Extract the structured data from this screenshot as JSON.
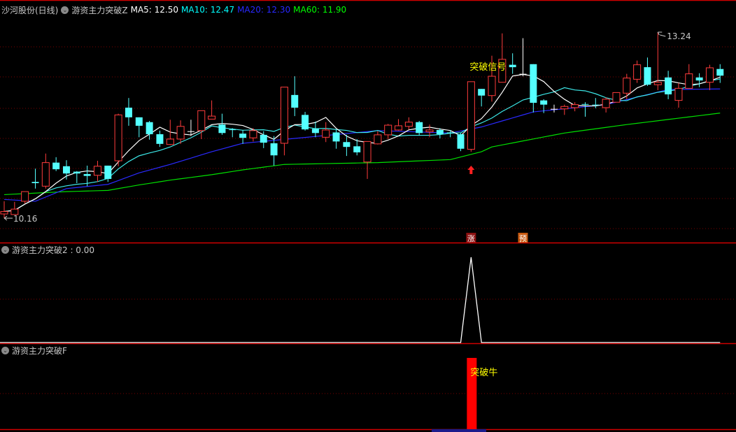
{
  "header": {
    "stock": "沙河股份(日线)",
    "indicator": "游资主力突破Z",
    "ma5": "MA5: 12.50",
    "ma10": "MA10: 12.47",
    "ma20": "MA20: 12.30",
    "ma60": "MA60: 11.90"
  },
  "panel2": {
    "title": "游资主力突破2 : 0.00"
  },
  "panel3": {
    "title": "游资主力突破F",
    "bar_label": "突破牛"
  },
  "markers": {
    "signal_label": "突破信号",
    "high_label": "13.24",
    "low_label": "10.16",
    "rise_tag": "涨",
    "pre_tag": "预"
  },
  "colors": {
    "up": "#ff3c3c",
    "down": "#54ffff",
    "ma5": "#ffffff",
    "ma10": "#3ce8e8",
    "ma20": "#2a2aff",
    "ma60": "#00e000",
    "grid": "#7a0000",
    "border": "#d00000"
  },
  "chart_data": {
    "type": "candlestick",
    "price_range": [
      10.0,
      13.4
    ],
    "signal_index": 45,
    "pre_index": 50,
    "high_index": 63,
    "low_index": 0,
    "ohlc": [
      [
        10.23,
        10.44,
        10.16,
        10.27
      ],
      [
        10.22,
        10.43,
        10.22,
        10.31
      ],
      [
        10.44,
        10.6,
        10.4,
        10.6
      ],
      [
        10.76,
        10.98,
        10.65,
        10.74
      ],
      [
        10.69,
        11.23,
        10.65,
        11.08
      ],
      [
        11.08,
        11.17,
        10.94,
        10.97
      ],
      [
        11.02,
        11.12,
        10.8,
        10.9
      ],
      [
        10.93,
        10.94,
        10.74,
        10.9
      ],
      [
        10.89,
        11.03,
        10.69,
        10.86
      ],
      [
        10.87,
        11.11,
        10.76,
        11.02
      ],
      [
        11.03,
        11.03,
        10.76,
        10.81
      ],
      [
        11.11,
        11.89,
        11.02,
        11.87
      ],
      [
        11.99,
        12.15,
        11.69,
        11.83
      ],
      [
        11.83,
        11.83,
        11.5,
        11.69
      ],
      [
        11.75,
        11.77,
        11.46,
        11.55
      ],
      [
        11.55,
        11.61,
        11.34,
        11.39
      ],
      [
        11.38,
        11.79,
        11.37,
        11.47
      ],
      [
        11.47,
        11.78,
        11.39,
        11.68
      ],
      [
        11.6,
        11.79,
        11.52,
        11.6
      ],
      [
        11.61,
        11.94,
        11.47,
        11.94
      ],
      [
        11.8,
        12.11,
        11.8,
        11.85
      ],
      [
        11.71,
        11.89,
        11.54,
        11.57
      ],
      [
        11.63,
        11.65,
        11.5,
        11.62
      ],
      [
        11.56,
        11.62,
        11.39,
        11.49
      ],
      [
        11.49,
        11.65,
        11.43,
        11.61
      ],
      [
        11.54,
        11.6,
        11.32,
        11.41
      ],
      [
        11.4,
        11.52,
        11.03,
        11.2
      ],
      [
        11.4,
        12.33,
        11.2,
        12.33
      ],
      [
        12.2,
        12.51,
        11.85,
        11.99
      ],
      [
        11.87,
        11.92,
        11.61,
        11.63
      ],
      [
        11.64,
        11.76,
        11.5,
        11.57
      ],
      [
        11.5,
        11.75,
        11.42,
        11.62
      ],
      [
        11.58,
        11.63,
        11.31,
        11.43
      ],
      [
        11.42,
        11.54,
        11.19,
        11.34
      ],
      [
        11.35,
        11.47,
        11.2,
        11.25
      ],
      [
        11.09,
        11.43,
        10.81,
        11.43
      ],
      [
        11.39,
        11.6,
        11.38,
        11.54
      ],
      [
        11.54,
        11.72,
        11.47,
        11.7
      ],
      [
        11.62,
        11.8,
        11.61,
        11.69
      ],
      [
        11.68,
        11.83,
        11.63,
        11.75
      ],
      [
        11.75,
        11.77,
        11.53,
        11.57
      ],
      [
        11.59,
        11.71,
        11.5,
        11.62
      ],
      [
        11.62,
        11.65,
        11.48,
        11.55
      ],
      [
        11.58,
        11.62,
        11.5,
        11.57
      ],
      [
        11.55,
        11.57,
        11.27,
        11.31
      ],
      [
        11.3,
        12.42,
        11.26,
        12.42
      ],
      [
        12.3,
        12.3,
        12.01,
        12.19
      ],
      [
        12.19,
        12.85,
        12.09,
        12.51
      ],
      [
        12.41,
        13.22,
        12.41,
        12.79
      ],
      [
        12.7,
        12.89,
        12.55,
        12.66
      ],
      [
        12.55,
        13.14,
        12.51,
        12.55
      ],
      [
        12.71,
        12.71,
        11.91,
        12.07
      ],
      [
        12.11,
        12.13,
        11.9,
        12.04
      ],
      [
        11.97,
        12.04,
        11.91,
        11.97
      ],
      [
        11.97,
        12.04,
        11.87,
        12.01
      ],
      [
        11.99,
        12.08,
        11.93,
        12.04
      ],
      [
        12.05,
        12.08,
        11.84,
        12.04
      ],
      [
        12.04,
        12.15,
        11.98,
        12.03
      ],
      [
        11.99,
        12.16,
        11.91,
        12.13
      ],
      [
        12.08,
        12.24,
        12.08,
        12.24
      ],
      [
        12.23,
        12.55,
        12.13,
        12.48
      ],
      [
        12.46,
        12.77,
        12.4,
        12.7
      ],
      [
        12.66,
        12.82,
        12.35,
        12.37
      ],
      [
        12.37,
        13.24,
        12.28,
        12.41
      ],
      [
        12.49,
        12.6,
        12.13,
        12.21
      ],
      [
        12.11,
        12.4,
        11.99,
        12.31
      ],
      [
        12.31,
        12.71,
        12.31,
        12.55
      ],
      [
        12.49,
        12.56,
        12.33,
        12.44
      ],
      [
        12.41,
        12.7,
        12.28,
        12.65
      ],
      [
        12.63,
        12.71,
        12.4,
        12.52
      ]
    ],
    "ma20_anchors": [
      [
        0,
        10.47
      ],
      [
        3,
        10.44
      ],
      [
        6,
        10.65
      ],
      [
        10,
        10.72
      ],
      [
        13,
        10.91
      ],
      [
        16,
        11.05
      ],
      [
        20,
        11.26
      ],
      [
        23,
        11.4
      ],
      [
        36,
        11.61
      ],
      [
        43,
        11.57
      ],
      [
        46,
        11.67
      ],
      [
        51,
        11.92
      ],
      [
        58,
        12.04
      ],
      [
        64,
        12.29
      ],
      [
        69,
        12.3
      ]
    ],
    "ma60_anchors": [
      [
        0,
        10.55
      ],
      [
        6,
        10.6
      ],
      [
        10,
        10.62
      ],
      [
        13,
        10.71
      ],
      [
        16,
        10.79
      ],
      [
        20,
        10.88
      ],
      [
        23,
        10.96
      ],
      [
        27,
        11.05
      ],
      [
        36,
        11.08
      ],
      [
        43,
        11.13
      ],
      [
        46,
        11.26
      ],
      [
        47,
        11.34
      ],
      [
        54,
        11.57
      ],
      [
        60,
        11.71
      ],
      [
        69,
        11.9
      ]
    ],
    "breakout2_values_nonzero": [
      [
        45,
        1
      ]
    ],
    "breakoutF_bars": [
      [
        45,
        1
      ]
    ]
  }
}
